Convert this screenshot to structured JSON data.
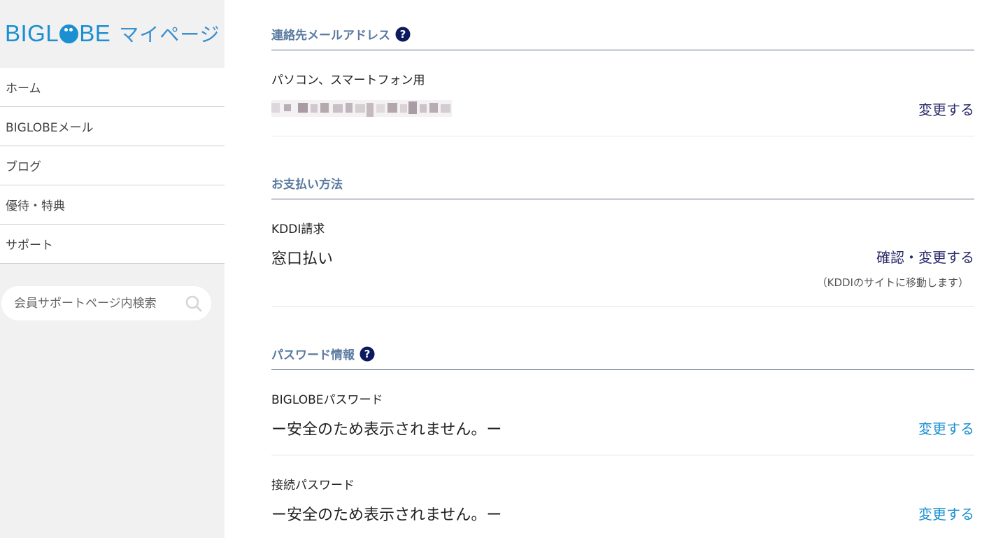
{
  "logo": {
    "brand_left": "BIGL",
    "brand_right": "BE",
    "subtitle": "マイページ"
  },
  "nav": {
    "items": [
      {
        "label": "ホーム"
      },
      {
        "label": "BIGLOBEメール"
      },
      {
        "label": "ブログ"
      },
      {
        "label": "優待・特典"
      },
      {
        "label": "サポート"
      }
    ]
  },
  "search": {
    "placeholder": "会員サポートページ内検索"
  },
  "contact_email": {
    "title": "連絡先メールアドレス",
    "label": "パソコン、スマートフォン用",
    "change_label": "変更する"
  },
  "payment": {
    "title": "お支払い方法",
    "label": "KDDI請求",
    "value": "窓口払い",
    "action_label": "確認・変更する",
    "note": "（KDDIのサイトに移動します）"
  },
  "password": {
    "title": "パスワード情報",
    "biglobe_label": "BIGLOBEパスワード",
    "biglobe_value": "ー安全のため表示されません。ー",
    "biglobe_change": "変更する",
    "connection_label": "接続パスワード",
    "connection_value": "ー安全のため表示されません。ー",
    "connection_change": "変更する"
  },
  "colors": {
    "accent": "#1a8fd1",
    "heading": "#5a7aa0",
    "dark_link": "#2a2a6a"
  }
}
